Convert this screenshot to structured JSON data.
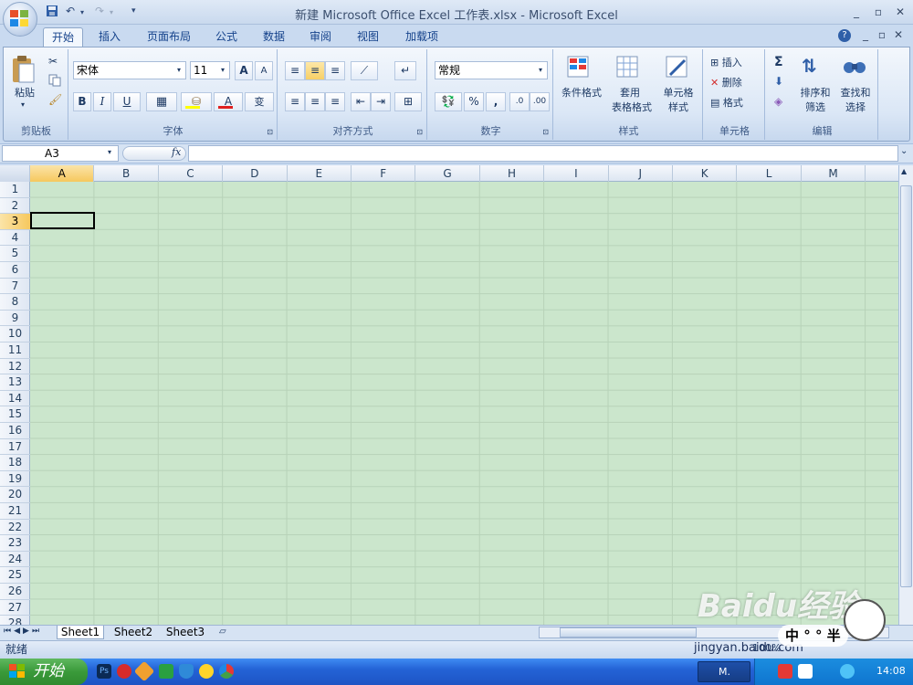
{
  "window": {
    "title": "新建 Microsoft Office Excel 工作表.xlsx - Microsoft Excel",
    "quick_access": [
      "💾",
      "↶",
      "↷"
    ],
    "controls": [
      "_",
      "▫",
      "✕"
    ],
    "doc_controls": [
      "?",
      "_",
      "▫",
      "✕"
    ]
  },
  "tabs": [
    "开始",
    "插入",
    "页面布局",
    "公式",
    "数据",
    "审阅",
    "视图",
    "加载项"
  ],
  "ribbon": {
    "clipboard": {
      "label": "剪贴板",
      "paste": "粘贴"
    },
    "font": {
      "label": "字体",
      "font_name": "宋体",
      "font_size": "11",
      "bold": "B",
      "italic": "I",
      "underline": "U",
      "grow": "A",
      "shrink": "A",
      "wen": "变"
    },
    "alignment": {
      "label": "对齐方式"
    },
    "number": {
      "label": "数字",
      "format": "常规",
      "percent": "%",
      "comma": ",",
      "inc_dec": ".0",
      "dec_dec": ".00"
    },
    "styles": {
      "label": "样式",
      "cond": "条件格式",
      "table1": "套用",
      "table2": "表格格式",
      "cell1": "单元格",
      "cell2": "样式"
    },
    "cells": {
      "label": "单元格",
      "insert": "插入",
      "delete": "删除",
      "format": "格式"
    },
    "editing": {
      "label": "编辑",
      "sort1": "排序和",
      "sort2": "筛选",
      "find1": "查找和",
      "find2": "选择",
      "sigma": "Σ"
    }
  },
  "formula_bar": {
    "name_box": "A3",
    "fx": "fx"
  },
  "columns": [
    "A",
    "B",
    "C",
    "D",
    "E",
    "F",
    "G",
    "H",
    "I",
    "J",
    "K",
    "L",
    "M"
  ],
  "rows": [
    "1",
    "2",
    "3",
    "4",
    "5",
    "6",
    "7",
    "8",
    "9",
    "10",
    "11",
    "12",
    "13",
    "14",
    "15",
    "16",
    "17",
    "18",
    "19",
    "20",
    "21",
    "22",
    "23",
    "24",
    "25",
    "26",
    "27",
    "28"
  ],
  "active_cell": "A3",
  "sheet_tabs": [
    "Sheet1",
    "Sheet2",
    "Sheet3"
  ],
  "status": {
    "text": "就绪",
    "zoom": "100%"
  },
  "taskbar": {
    "start": "开始",
    "task": "M.",
    "clock": "14:08"
  },
  "watermark": {
    "text": "Baidu经验",
    "url": "jingyan.baidu.com",
    "ime": "中 ° ° 半"
  }
}
